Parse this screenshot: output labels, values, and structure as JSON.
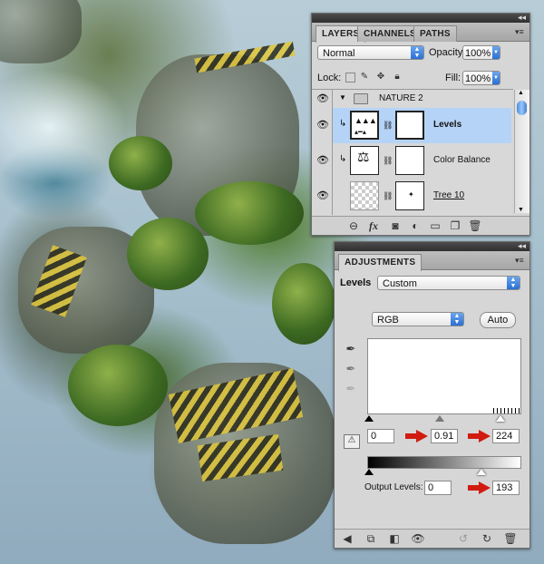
{
  "layers_panel": {
    "tabs": [
      "LAYERS",
      "CHANNELS",
      "PATHS"
    ],
    "active_tab": "LAYERS",
    "blend_mode": "Normal",
    "opacity_label": "Opacity:",
    "opacity_value": "100%",
    "lock_label": "Lock:",
    "fill_label": "Fill:",
    "fill_value": "100%",
    "group_name": "NATURE 2",
    "layers": [
      {
        "name": "Levels",
        "selected": true,
        "underline": false
      },
      {
        "name": "Color Balance",
        "selected": false,
        "underline": false
      },
      {
        "name": "Tree 10",
        "selected": false,
        "underline": true
      }
    ]
  },
  "adjustments_panel": {
    "tab": "ADJUSTMENTS",
    "levels_label": "Levels",
    "preset_value": "Custom",
    "channel_value": "RGB",
    "auto_button": "Auto",
    "input_black": "0",
    "input_gamma": "0.91",
    "input_white": "224",
    "output_label": "Output Levels:",
    "output_black": "0",
    "output_white": "193"
  },
  "colors": {
    "selection": "#b5d3f7",
    "arrow_red": "#d11b10",
    "accent_blue": "#2a6fd6"
  }
}
